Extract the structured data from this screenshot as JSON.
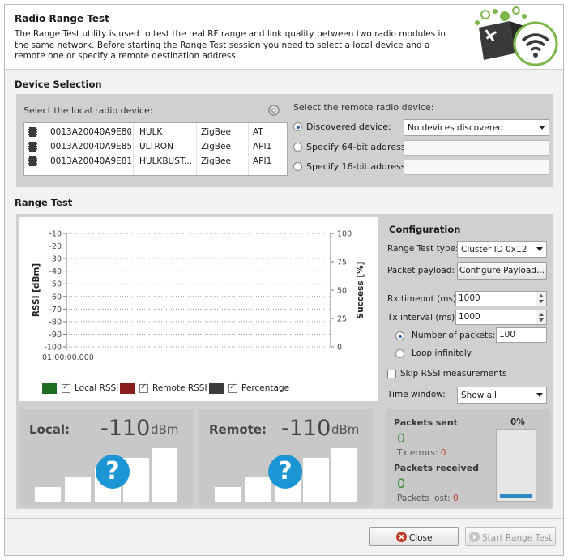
{
  "header": {
    "title": "Radio Range Test",
    "description": "The Range Test utility is used to test the real RF range and link quality between two radio modules in the same network. Before starting the Range Test session you need to select a local device and a remote one or specify a remote destination address."
  },
  "device_selection": {
    "section_title": "Device Selection",
    "local_title": "Select the local radio device:",
    "devices": [
      {
        "address": "0013A20040A9E805",
        "name": "HULK",
        "protocol": "ZigBee",
        "mode": "AT"
      },
      {
        "address": "0013A20040A9E85B",
        "name": "ULTRON",
        "protocol": "ZigBee",
        "mode": "API1"
      },
      {
        "address": "0013A20040A9E81B",
        "name": "HULKBUST...",
        "protocol": "ZigBee",
        "mode": "API1"
      }
    ],
    "remote_title": "Select the remote radio device:",
    "discovered_label": "Discovered device:",
    "discovered_value": "No devices discovered",
    "addr64_label": "Specify 64-bit address:",
    "addr16_label": "Specify 16-bit address:",
    "selected_remote_option": "discovered"
  },
  "range_test": {
    "section_title": "Range Test",
    "legend": [
      {
        "label": "Local RSSI",
        "color": "#1f6e22",
        "checked": true
      },
      {
        "label": "Remote RSSI",
        "color": "#8a1e1e",
        "checked": true
      },
      {
        "label": "Percentage",
        "color": "#3c3c3c",
        "checked": true
      }
    ]
  },
  "chart_data": {
    "type": "line",
    "ylabel": "RSSI [dBm]",
    "y2label": "Success [%]",
    "yticks": [
      "-10",
      "-20",
      "-30",
      "-40",
      "-50",
      "-60",
      "-70",
      "-80",
      "-90",
      "-100"
    ],
    "y2ticks": [
      "100",
      "75",
      "50",
      "25",
      "0"
    ],
    "ylim": [
      -100,
      -10
    ],
    "y2lim": [
      0,
      100
    ],
    "x_start_label": "01:00:00.000",
    "grid": true,
    "series": []
  },
  "configuration": {
    "title": "Configuration",
    "range_test_type_label": "Range Test type:",
    "range_test_type_value": "Cluster ID 0x12",
    "packet_payload_label": "Packet payload:",
    "configure_payload_button": "Configure Payload...",
    "rx_timeout_label": "Rx timeout (ms):",
    "rx_timeout_value": "1000",
    "tx_interval_label": "Tx interval (ms):",
    "tx_interval_value": "1000",
    "num_packets_label": "Number of packets:",
    "num_packets_value": "100",
    "loop_label": "Loop infinitely",
    "skip_rssi_label": "Skip RSSI measurements",
    "time_window_label": "Time window:",
    "time_window_value": "Show all"
  },
  "local_rssi": {
    "label": "Local:",
    "value": "-110",
    "unit": "dBm",
    "quality": "?"
  },
  "remote_rssi": {
    "label": "Remote:",
    "value": "-110",
    "unit": "dBm",
    "quality": "?"
  },
  "stats": {
    "packets_sent_label": "Packets sent",
    "packets_sent": "0",
    "tx_errors_label": "Tx errors:",
    "tx_errors": "0",
    "packets_received_label": "Packets received",
    "packets_received": "0",
    "packets_lost_label": "Packets lost:",
    "packets_lost": "0",
    "percentage": "0%"
  },
  "footer": {
    "close_label": "Close",
    "start_label": "Start Range Test"
  }
}
